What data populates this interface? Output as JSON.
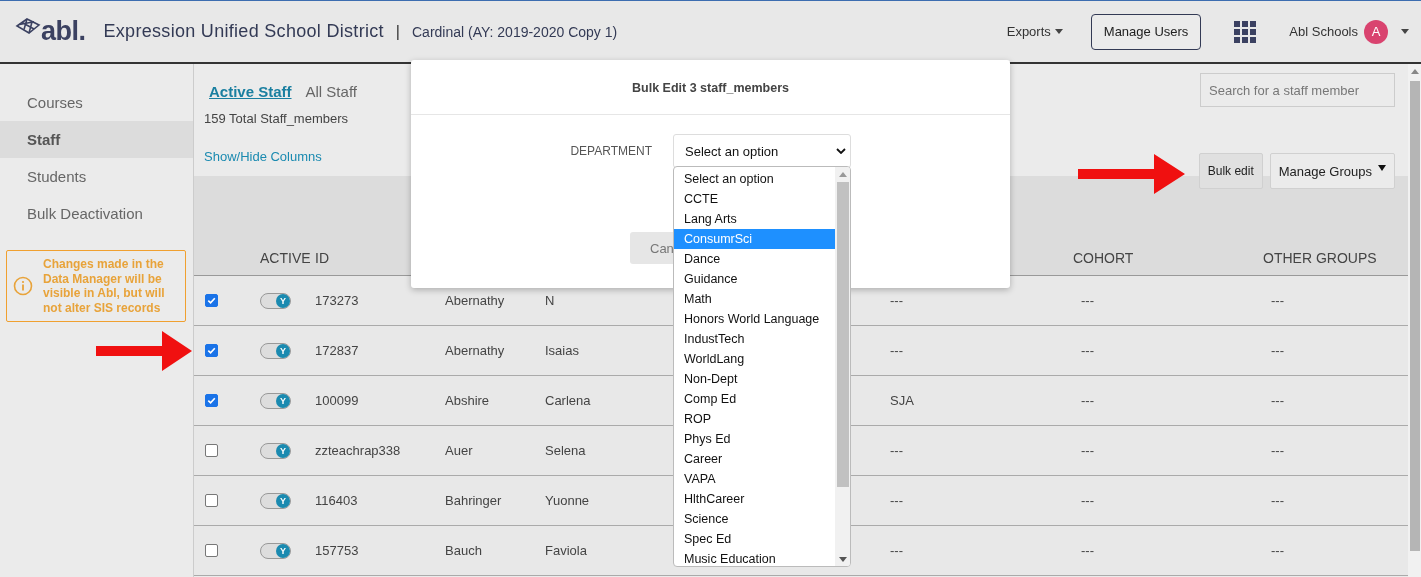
{
  "header": {
    "logo": "abl.",
    "district": "Expression Unified School District",
    "separator": "|",
    "term": "Cardinal (AY: 2019-2020 Copy 1)",
    "exports": "Exports",
    "manage_users": "Manage Users",
    "account": "Abl Schools",
    "avatar": "A"
  },
  "sidebar": {
    "items": [
      {
        "label": "Courses",
        "selected": false
      },
      {
        "label": "Staff",
        "selected": true
      },
      {
        "label": "Students",
        "selected": false
      },
      {
        "label": "Bulk Deactivation",
        "selected": false
      }
    ],
    "notice": "Changes made in the Data Manager will be visible in Abl, but will not alter SIS records"
  },
  "staff_tabs": [
    {
      "label": "Active Staff",
      "selected": true
    },
    {
      "label": "All Staff",
      "selected": false
    }
  ],
  "total": "159 Total Staff_members",
  "show_hide": "Show/Hide Columns",
  "search": {
    "placeholder": "Search for a staff member"
  },
  "bulk_edit": "Bulk edit",
  "manage_groups": "Manage Groups",
  "table": {
    "headers": {
      "active": "ACTIVE",
      "id": "ID",
      "cohort": "COHORT",
      "other_groups": "OTHER GROUPS"
    },
    "rows": [
      {
        "checked": true,
        "active": true,
        "active_label": "Y",
        "id": "173273",
        "last_name": "Abernathy",
        "first_name": "N",
        "column_6": "---",
        "cohort": "---",
        "other_groups": "---"
      },
      {
        "checked": true,
        "active": true,
        "active_label": "Y",
        "id": "172837",
        "last_name": "Abernathy",
        "first_name": "Isaias",
        "column_6": "---",
        "cohort": "---",
        "other_groups": "---"
      },
      {
        "checked": true,
        "active": true,
        "active_label": "Y",
        "id": "100099",
        "last_name": "Abshire",
        "first_name": "Carlena",
        "column_6": "SJA",
        "cohort": "---",
        "other_groups": "---"
      },
      {
        "checked": false,
        "active": true,
        "active_label": "Y",
        "id": "zzteachrap338",
        "last_name": "Auer",
        "first_name": "Selena",
        "column_6": "---",
        "cohort": "---",
        "other_groups": "---"
      },
      {
        "checked": false,
        "active": true,
        "active_label": "Y",
        "id": "116403",
        "last_name": "Bahringer",
        "first_name": "Yuonne",
        "column_6": "---",
        "cohort": "---",
        "other_groups": "---"
      },
      {
        "checked": false,
        "active": true,
        "active_label": "Y",
        "id": "157753",
        "last_name": "Bauch",
        "first_name": "Faviola",
        "column_6": "---",
        "cohort": "---",
        "other_groups": "---"
      }
    ]
  },
  "modal": {
    "title": "Bulk Edit 3 staff_members",
    "field_label": "DEPARTMENT",
    "select_value": "Select an option",
    "cancel": "Can",
    "options": [
      {
        "label": "Select an option",
        "selected": false
      },
      {
        "label": "CCTE",
        "selected": false
      },
      {
        "label": "Lang Arts",
        "selected": false
      },
      {
        "label": "ConsumrSci",
        "selected": true
      },
      {
        "label": "Dance",
        "selected": false
      },
      {
        "label": "Guidance",
        "selected": false
      },
      {
        "label": "Math",
        "selected": false
      },
      {
        "label": "Honors World Language",
        "selected": false
      },
      {
        "label": "IndustTech",
        "selected": false
      },
      {
        "label": "WorldLang",
        "selected": false
      },
      {
        "label": "Non-Dept",
        "selected": false
      },
      {
        "label": "Comp Ed",
        "selected": false
      },
      {
        "label": "ROP",
        "selected": false
      },
      {
        "label": "Phys Ed",
        "selected": false
      },
      {
        "label": "Career",
        "selected": false
      },
      {
        "label": "VAPA",
        "selected": false
      },
      {
        "label": "HlthCareer",
        "selected": false
      },
      {
        "label": "Science",
        "selected": false
      },
      {
        "label": "Spec Ed",
        "selected": false
      },
      {
        "label": "Music Education",
        "selected": false
      }
    ]
  }
}
